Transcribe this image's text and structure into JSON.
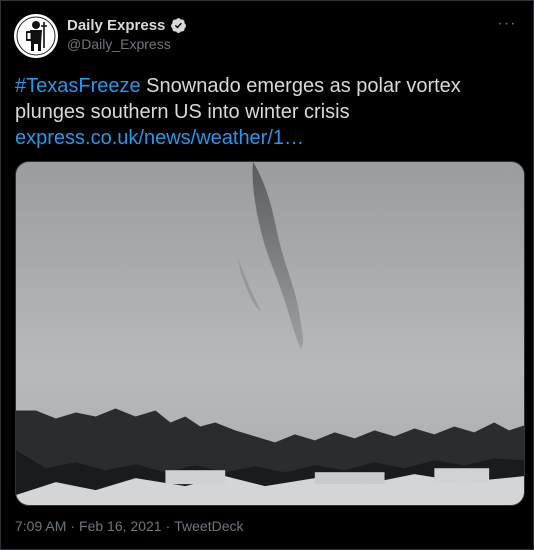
{
  "user": {
    "display_name": "Daily Express",
    "handle": "@Daily_Express",
    "verified": true
  },
  "tweet": {
    "hashtag": "#TexasFreeze",
    "text_line1": " Snownado emerges as polar vortex",
    "text_line2": "plunges southern US into winter crisis",
    "link": "express.co.uk/news/weather/1…"
  },
  "media": {
    "icon": "snownado-photo"
  },
  "meta": {
    "time": "7:09 AM",
    "sep1": "·",
    "date": "Feb 16, 2021",
    "sep2": "·",
    "source": "TweetDeck"
  },
  "more_icon": "···",
  "colors": {
    "background": "#000000",
    "text": "#d9d9d9",
    "link": "#1d9bf0",
    "muted": "#6e767d"
  }
}
